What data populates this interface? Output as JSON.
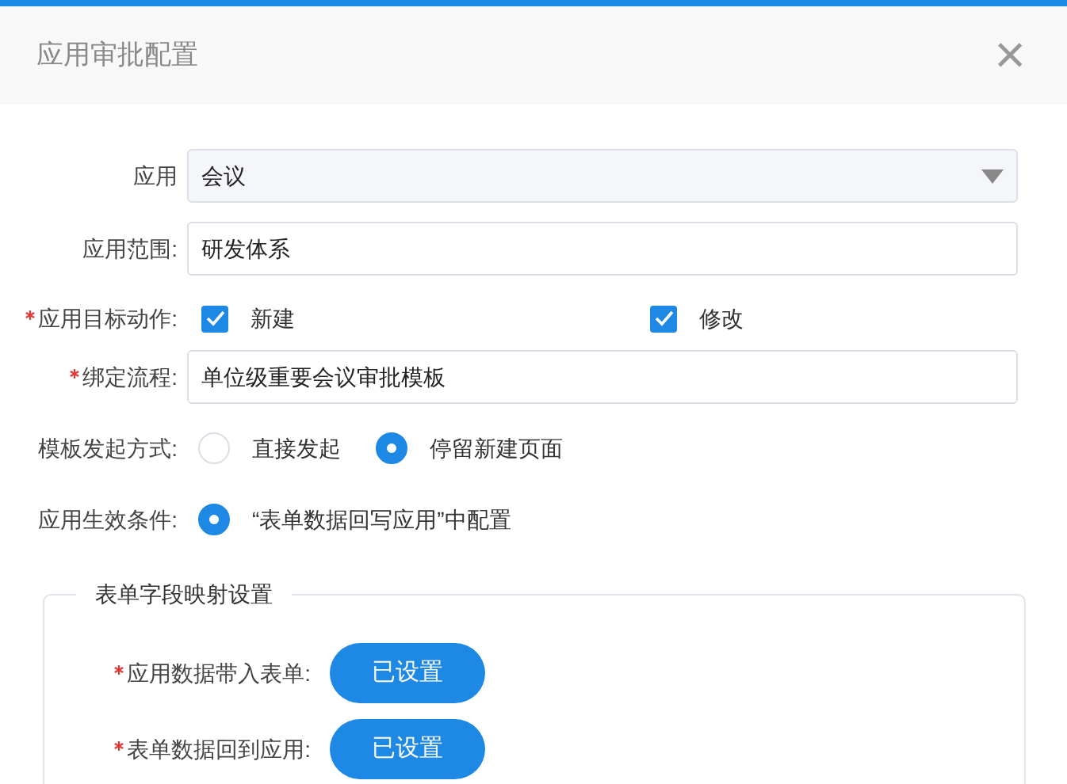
{
  "dialog": {
    "title": "应用审批配置",
    "close": "×"
  },
  "rows": [
    {
      "kind": "select",
      "label": "应用",
      "required": false,
      "value": "会议"
    },
    {
      "kind": "text",
      "label": "应用范围:",
      "required": false,
      "value": "研发体系"
    },
    {
      "kind": "checkbox",
      "label": "应用目标动作:",
      "required": true,
      "options": [
        {
          "label": "新建",
          "checked": true
        },
        {
          "label": "修改",
          "checked": true
        }
      ]
    },
    {
      "kind": "text",
      "label": "绑定流程:",
      "required": true,
      "value": "单位级重要会议审批模板"
    },
    {
      "kind": "radio",
      "label": "模板发起方式:",
      "required": false,
      "options": [
        {
          "label": "直接发起",
          "selected": false
        },
        {
          "label": "停留新建页面",
          "selected": true
        }
      ]
    },
    {
      "kind": "radio",
      "label": "应用生效条件:",
      "required": false,
      "options": [
        {
          "label": "“表单数据回写应用”中配置",
          "selected": true
        }
      ]
    }
  ],
  "mapping": {
    "legend": "表单字段映射设置",
    "rows": [
      {
        "label": "应用数据带入表单:",
        "required": true,
        "button": "已设置"
      },
      {
        "label": "表单数据回到应用:",
        "required": true,
        "button": "已设置"
      }
    ]
  }
}
